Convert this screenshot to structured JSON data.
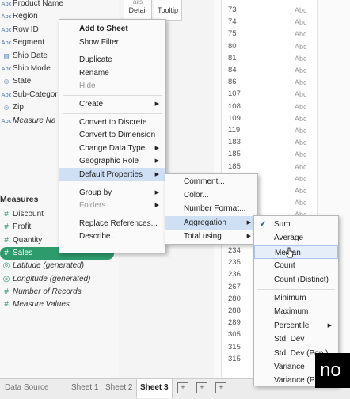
{
  "data_pane": {
    "dimensions": [
      {
        "icon": "Abc",
        "name": "Product Name"
      },
      {
        "icon": "Abc",
        "name": "Region"
      },
      {
        "icon": "Abc",
        "name": "Row ID"
      },
      {
        "icon": "Abc",
        "name": "Segment"
      },
      {
        "icon": "calendar",
        "name": "Ship Date"
      },
      {
        "icon": "Abc",
        "name": "Ship Mode"
      },
      {
        "icon": "globe",
        "name": "State"
      },
      {
        "icon": "Abc",
        "name": "Sub-Categor"
      },
      {
        "icon": "globe",
        "name": "Zip"
      },
      {
        "icon": "Abc",
        "name": "Measure Na"
      }
    ],
    "measures_header": "Measures",
    "measures": [
      {
        "icon": "#",
        "name": "Discount"
      },
      {
        "icon": "#",
        "name": "Profit"
      },
      {
        "icon": "#",
        "name": "Quantity"
      },
      {
        "icon": "#",
        "name": "Sales"
      },
      {
        "icon": "globe",
        "name": "Latitude (generated)"
      },
      {
        "icon": "globe",
        "name": "Longitude (generated)"
      },
      {
        "icon": "#",
        "name": "Number of Records"
      },
      {
        "icon": "#",
        "name": "Measure Values"
      }
    ]
  },
  "marks": {
    "detail": "Detail",
    "tooltip": "Tooltip",
    "above": "ails"
  },
  "table_rows": [
    [
      "73",
      "Abc"
    ],
    [
      "74",
      "Abc"
    ],
    [
      "75",
      "Abc"
    ],
    [
      "80",
      "Abc"
    ],
    [
      "81",
      "Abc"
    ],
    [
      "84",
      "Abc"
    ],
    [
      "86",
      "Abc"
    ],
    [
      "107",
      "Abc"
    ],
    [
      "108",
      "Abc"
    ],
    [
      "109",
      "Abc"
    ],
    [
      "119",
      "Abc"
    ],
    [
      "183",
      "Abc"
    ],
    [
      "185",
      "Abc"
    ],
    [
      "185",
      "Abc"
    ],
    [
      "",
      "Abc"
    ],
    [
      "",
      "Abc"
    ],
    [
      "",
      "Abc"
    ],
    [
      "",
      "Abc"
    ],
    [
      "",
      "Abc"
    ],
    [
      "",
      "Abc"
    ],
    [
      "234",
      "Abc"
    ],
    [
      "235",
      "Abc"
    ],
    [
      "236",
      "Abc"
    ],
    [
      "267",
      "Abc"
    ],
    [
      "280",
      "Abc"
    ],
    [
      "288",
      "Abc"
    ],
    [
      "289",
      "Abc"
    ],
    [
      "305",
      "Abc"
    ],
    [
      "315",
      "Abc"
    ],
    [
      "315",
      "Abc"
    ]
  ],
  "context_menu": [
    {
      "label": "Add to Sheet",
      "bold": true
    },
    {
      "label": "Show Filter"
    },
    {
      "sep": true
    },
    {
      "label": "Duplicate"
    },
    {
      "label": "Rename"
    },
    {
      "label": "Hide",
      "disabled": true
    },
    {
      "sep": true
    },
    {
      "label": "Create",
      "arrow": true
    },
    {
      "sep": true
    },
    {
      "label": "Convert to Discrete"
    },
    {
      "label": "Convert to Dimension"
    },
    {
      "label": "Change Data Type",
      "arrow": true
    },
    {
      "label": "Geographic Role",
      "arrow": true
    },
    {
      "label": "Default Properties",
      "arrow": true,
      "state": "hl"
    },
    {
      "sep": true
    },
    {
      "label": "Group by",
      "arrow": true
    },
    {
      "label": "Folders",
      "arrow": true,
      "disabled": true
    },
    {
      "sep": true
    },
    {
      "label": "Replace References..."
    },
    {
      "label": "Describe..."
    }
  ],
  "default_properties_menu": [
    {
      "label": "Comment..."
    },
    {
      "label": "Color..."
    },
    {
      "label": "Number Format..."
    },
    {
      "label": "Aggregation",
      "arrow": true,
      "state": "hl"
    },
    {
      "label": "Total using",
      "arrow": true
    }
  ],
  "aggregation_menu": [
    {
      "label": "Sum",
      "checked": true
    },
    {
      "label": "Average"
    },
    {
      "label": "Median",
      "state": "hover"
    },
    {
      "label": "Count"
    },
    {
      "label": "Count (Distinct)"
    },
    {
      "sep": true
    },
    {
      "label": "Minimum"
    },
    {
      "label": "Maximum"
    },
    {
      "label": "Percentile",
      "arrow": true
    },
    {
      "label": "Std. Dev"
    },
    {
      "label": "Std. Dev (Pop.)"
    },
    {
      "label": "Variance"
    },
    {
      "label": "Variance (Pop.)"
    }
  ],
  "bottom_bar": {
    "data_source": "Data Source",
    "tabs": [
      "Sheet 1",
      "Sheet 2",
      "Sheet 3"
    ],
    "active_tab": "Sheet 3"
  },
  "overlay_text": "no",
  "colors": {
    "selected_green": "#2d9b6b",
    "dimension_blue": "#4a78b4",
    "highlight": "#cfe0f5"
  }
}
